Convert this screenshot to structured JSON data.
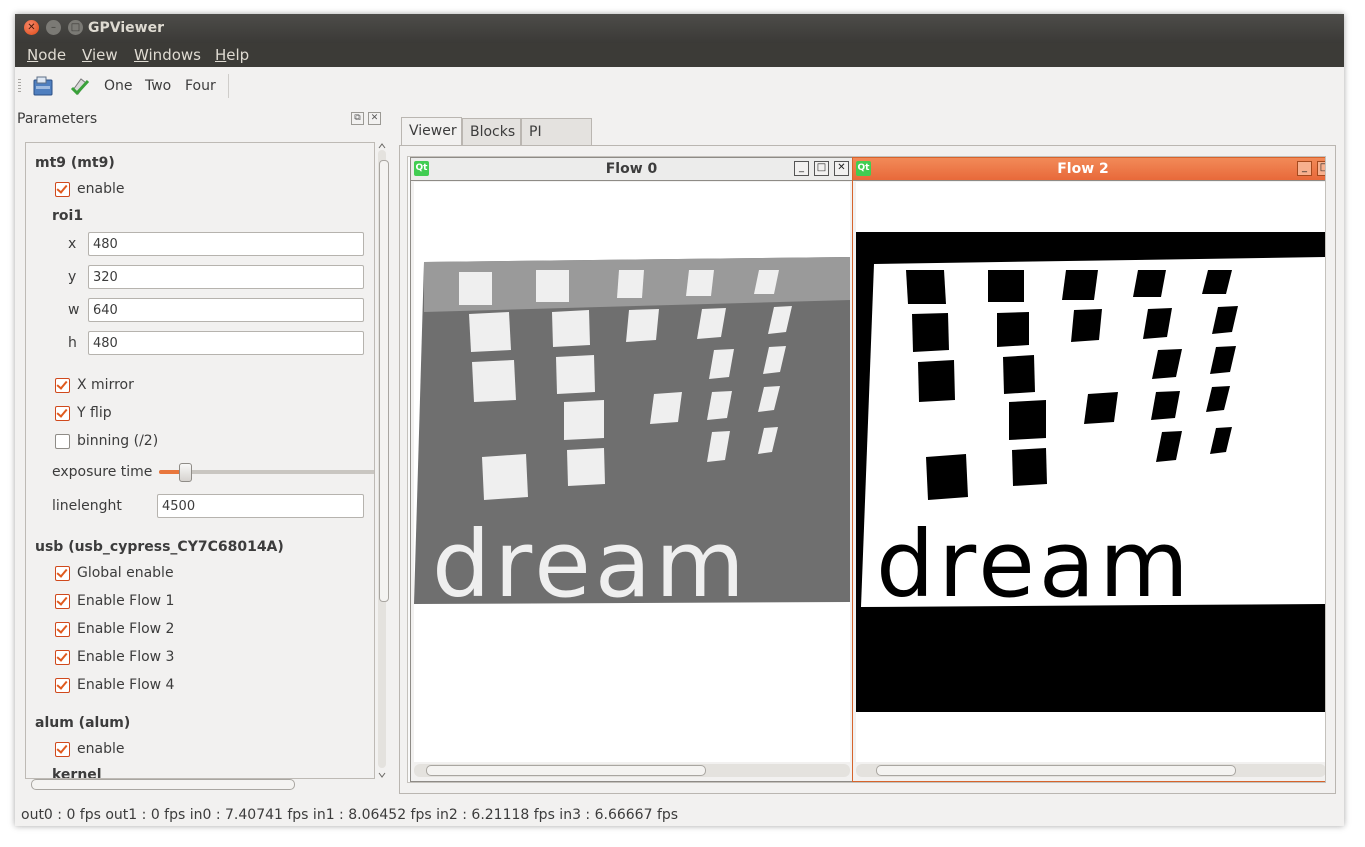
{
  "window": {
    "title": "GPViewer"
  },
  "menu": {
    "items": [
      "Node",
      "View",
      "Windows",
      "Help"
    ]
  },
  "toolbar": {
    "buttons": [
      "One",
      "Two",
      "Four"
    ]
  },
  "parameters": {
    "title": "Parameters",
    "mt9": {
      "header": "mt9 (mt9)",
      "enable": {
        "label": "enable",
        "checked": true
      },
      "roi": {
        "header": "roi1",
        "x": {
          "label": "x",
          "value": "480"
        },
        "y": {
          "label": "y",
          "value": "320"
        },
        "w": {
          "label": "w",
          "value": "640"
        },
        "h": {
          "label": "h",
          "value": "480"
        }
      },
      "x_mirror": {
        "label": "X mirror",
        "checked": true
      },
      "y_flip": {
        "label": "Y flip",
        "checked": true
      },
      "binning": {
        "label": "binning (/2)",
        "checked": false
      },
      "exposure": {
        "label": "exposure time",
        "level_fraction": 0.12
      },
      "linelength": {
        "label": "linelenght",
        "value": "4500"
      }
    },
    "usb": {
      "header": "usb (usb_cypress_CY7C68014A)",
      "items": [
        {
          "label": "Global enable",
          "checked": true
        },
        {
          "label": "Enable Flow 1",
          "checked": true
        },
        {
          "label": "Enable Flow 2",
          "checked": true
        },
        {
          "label": "Enable Flow 3",
          "checked": true
        },
        {
          "label": "Enable Flow 4",
          "checked": true
        }
      ]
    },
    "alum": {
      "header": "alum (alum)",
      "enable": {
        "label": "enable",
        "checked": true
      },
      "next_header": "kernel"
    }
  },
  "tabs": {
    "items": [
      "Viewer",
      "Blocks",
      "PI space"
    ],
    "active": "Viewer"
  },
  "flows": [
    {
      "title": "Flow 0",
      "badge": "Qt",
      "active": false,
      "image_text": "dream"
    },
    {
      "title": "Flow 2",
      "badge": "Qt",
      "active": true,
      "image_text": "dream"
    }
  ],
  "status": {
    "text": "out0 : 0 fps out1 : 0 fps in0 : 7.40741 fps in1 : 8.06452 fps in2 : 6.21118 fps in3 : 6.66667 fps"
  },
  "colors": {
    "accent": "#e8763c",
    "titlebar": "#3c3b37",
    "active_subwindow": "#ef7a45"
  }
}
